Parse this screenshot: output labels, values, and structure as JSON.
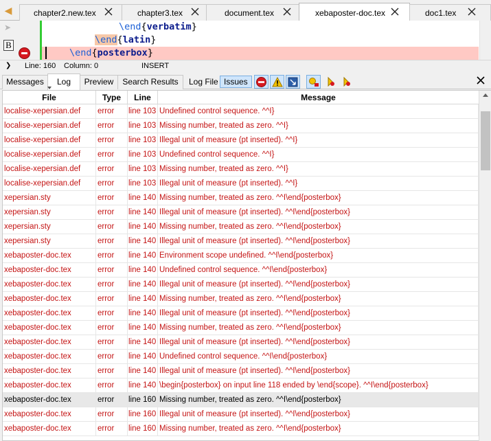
{
  "tabs": [
    {
      "label": "chapter2.new.tex",
      "active": false
    },
    {
      "label": "chapter3.tex",
      "active": false
    },
    {
      "label": "document.tex",
      "active": false
    },
    {
      "label": "xebaposter-doc.tex",
      "active": true
    },
    {
      "label": "doc1.tex",
      "active": false
    }
  ],
  "editor": {
    "lines": [
      {
        "command": "\\end",
        "open": "{",
        "argument": "verbatim",
        "close": "}"
      },
      {
        "command": "\\end",
        "open": "{",
        "argument": "latin",
        "close": "}"
      },
      {
        "command": "\\end",
        "open": "{",
        "argument": "posterbox",
        "close": "}"
      }
    ],
    "bookmark_glyph": "B",
    "error_marker": "error-icon"
  },
  "status": {
    "line": "Line: 160",
    "column": "Column: 0",
    "mode": "INSERT"
  },
  "panel": {
    "tabs": [
      "Messages",
      "Log",
      "Preview",
      "Search Results"
    ],
    "active_tab": "Log",
    "log_file_label": "Log File",
    "issues_label": "Issues"
  },
  "colors": {
    "error_text": "#c41414",
    "current_line": "#ffc9c4",
    "keyword": "#1a5fd6",
    "argument": "#0b1c8c",
    "fold_bar": "#33cc33",
    "selection": "#cfe5fb"
  },
  "log": {
    "columns": [
      "File",
      "Type",
      "Line",
      "Message"
    ],
    "rows": [
      {
        "file": "localise-xepersian.def",
        "type": "error",
        "line": "line 103",
        "message": "Undefined control sequence. ^^I}",
        "selected": false
      },
      {
        "file": "localise-xepersian.def",
        "type": "error",
        "line": "line 103",
        "message": "Missing number, treated as zero. ^^I}",
        "selected": false
      },
      {
        "file": "localise-xepersian.def",
        "type": "error",
        "line": "line 103",
        "message": "Illegal unit of measure (pt inserted). ^^I}",
        "selected": false
      },
      {
        "file": "localise-xepersian.def",
        "type": "error",
        "line": "line 103",
        "message": "Undefined control sequence. ^^I}",
        "selected": false
      },
      {
        "file": "localise-xepersian.def",
        "type": "error",
        "line": "line 103",
        "message": "Missing number, treated as zero. ^^I}",
        "selected": false
      },
      {
        "file": "localise-xepersian.def",
        "type": "error",
        "line": "line 103",
        "message": "Illegal unit of measure (pt inserted). ^^I}",
        "selected": false
      },
      {
        "file": "xepersian.sty",
        "type": "error",
        "line": "line 140",
        "message": "Missing number, treated as zero. ^^I\\end{posterbox}",
        "selected": false
      },
      {
        "file": "xepersian.sty",
        "type": "error",
        "line": "line 140",
        "message": "Illegal unit of measure (pt inserted). ^^I\\end{posterbox}",
        "selected": false
      },
      {
        "file": "xepersian.sty",
        "type": "error",
        "line": "line 140",
        "message": "Missing number, treated as zero. ^^I\\end{posterbox}",
        "selected": false
      },
      {
        "file": "xepersian.sty",
        "type": "error",
        "line": "line 140",
        "message": "Illegal unit of measure (pt inserted). ^^I\\end{posterbox}",
        "selected": false
      },
      {
        "file": "xebaposter-doc.tex",
        "type": "error",
        "line": "line 140",
        "message": "Environment scope undefined. ^^I\\end{posterbox}",
        "selected": false
      },
      {
        "file": "xebaposter-doc.tex",
        "type": "error",
        "line": "line 140",
        "message": "Undefined control sequence. ^^I\\end{posterbox}",
        "selected": false
      },
      {
        "file": "xebaposter-doc.tex",
        "type": "error",
        "line": "line 140",
        "message": "Illegal unit of measure (pt inserted). ^^I\\end{posterbox}",
        "selected": false
      },
      {
        "file": "xebaposter-doc.tex",
        "type": "error",
        "line": "line 140",
        "message": "Missing number, treated as zero. ^^I\\end{posterbox}",
        "selected": false
      },
      {
        "file": "xebaposter-doc.tex",
        "type": "error",
        "line": "line 140",
        "message": "Illegal unit of measure (pt inserted). ^^I\\end{posterbox}",
        "selected": false
      },
      {
        "file": "xebaposter-doc.tex",
        "type": "error",
        "line": "line 140",
        "message": "Missing number, treated as zero. ^^I\\end{posterbox}",
        "selected": false
      },
      {
        "file": "xebaposter-doc.tex",
        "type": "error",
        "line": "line 140",
        "message": "Illegal unit of measure (pt inserted). ^^I\\end{posterbox}",
        "selected": false
      },
      {
        "file": "xebaposter-doc.tex",
        "type": "error",
        "line": "line 140",
        "message": "Undefined control sequence. ^^I\\end{posterbox}",
        "selected": false
      },
      {
        "file": "xebaposter-doc.tex",
        "type": "error",
        "line": "line 140",
        "message": "Illegal unit of measure (pt inserted). ^^I\\end{posterbox}",
        "selected": false
      },
      {
        "file": "xebaposter-doc.tex",
        "type": "error",
        "line": "line 140",
        "message": "\\begin{posterbox} on input line 118 ended by \\end{scope}. ^^I\\end{posterbox}",
        "selected": false
      },
      {
        "file": "xebaposter-doc.tex",
        "type": "error",
        "line": "line 160",
        "message": "Missing number, treated as zero. ^^I\\end{posterbox}",
        "selected": true
      },
      {
        "file": "xebaposter-doc.tex",
        "type": "error",
        "line": "line 160",
        "message": "Illegal unit of measure (pt inserted). ^^I\\end{posterbox}",
        "selected": false
      },
      {
        "file": "xebaposter-doc.tex",
        "type": "error",
        "line": "line 160",
        "message": "Missing number, treated as zero. ^^I\\end{posterbox}",
        "selected": false
      }
    ]
  }
}
